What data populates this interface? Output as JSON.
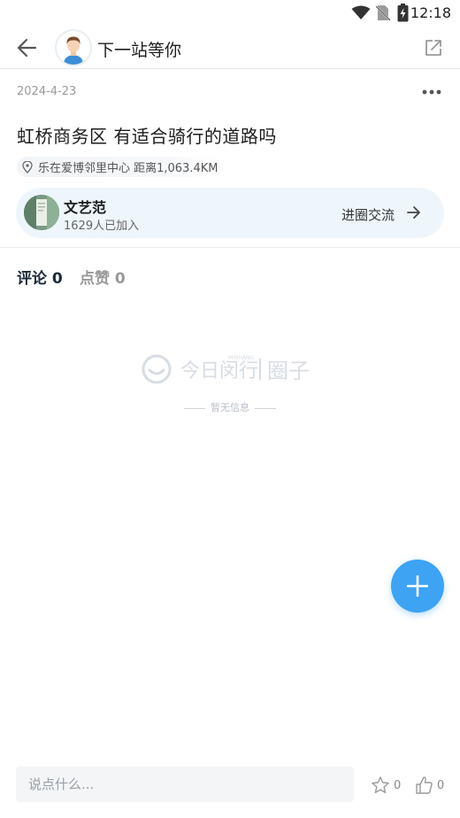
{
  "status_bar": {
    "time": "12:18"
  },
  "header": {
    "title": "下一站等你"
  },
  "post": {
    "date": "2024-4-23",
    "title": "虹桥商务区 有适合骑行的道路吗",
    "location": "乐在爱博邻里中心 距离1,063.4KM"
  },
  "circle": {
    "name": "文艺范",
    "members": "1629人已加入",
    "enter_label": "进圈交流"
  },
  "tabs": [
    {
      "label": "评论 0"
    },
    {
      "label": "点赞 0"
    }
  ],
  "empty_state": {
    "logo_brand": "今日闵行",
    "logo_brand_sub": "MINHANG",
    "logo_section": "圈子",
    "message": "暂无信息"
  },
  "bottom_bar": {
    "input_placeholder": "说点什么...",
    "star_count": "0",
    "like_count": "0"
  },
  "colors": {
    "accent": "#3ea3f2",
    "card_bg": "#eef6fc",
    "input_bg": "#f3f5f7"
  }
}
